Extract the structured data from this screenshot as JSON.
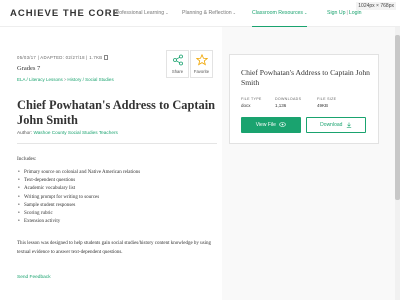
{
  "header": {
    "logo": "ACHIEVE THE CORE",
    "nav": [
      {
        "label": "Professional Learning"
      },
      {
        "label": "Planning & Reflection"
      },
      {
        "label": "Classroom Resources"
      }
    ],
    "sign_up": "Sign Up",
    "login": "Login",
    "separator": "|"
  },
  "viewport_label": "1024px × 768px",
  "resource": {
    "meta": "05/03/17  |  ADAPTED: 02/27/18  |  1.7KB",
    "grade": "Grades 7",
    "tags": [
      "ELA / Literacy Lessons",
      "History / Social Studies"
    ],
    "tag_separator": ">",
    "share_label": "Share",
    "favorite_label": "Favorite",
    "title": "Chief Powhatan's Address to Captain John Smith",
    "author_prefix": "Author:",
    "author": "Washoe County Social Studies Teachers",
    "includes_heading": "Includes:",
    "includes": [
      "Primary source on colonial and Native American relations",
      "Text-dependent questions",
      "Academic vocabulary list",
      "Writing prompt for writing to sources",
      "Sample student responses",
      "Scoring rubric",
      "Extension activity"
    ],
    "description": "This lesson was designed to help students gain social studies/history content knowledge by using textual evidence to answer text-dependent questions.",
    "feedback_link": "Send Feedback"
  },
  "card": {
    "title": "Chief Powhatan's Address to Captain John Smith",
    "file_type_label": "FILE TYPE",
    "file_type": "docx",
    "downloads_label": "DOWNLOADS",
    "downloads": "1,136",
    "file_size_label": "FILE SIZE",
    "file_size": "49KB",
    "view_label": "View File",
    "download_label": "Download"
  },
  "colors": {
    "accent": "#1aa36f",
    "text": "#333333",
    "page_bg": "#f9f9f9"
  },
  "icons": [
    "share-icon",
    "star-icon",
    "file-icon",
    "eye-icon",
    "download-icon",
    "chevron-down-icon"
  ]
}
